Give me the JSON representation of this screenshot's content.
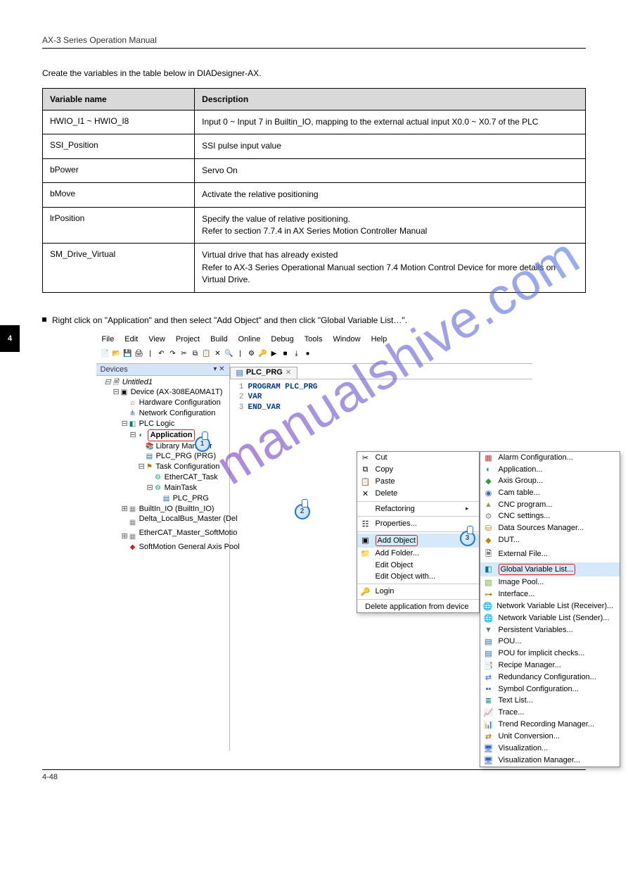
{
  "header": {
    "title": "AX-3 Series Operation Manual"
  },
  "intro": "Create the variables in the table below in DIADesigner-AX.",
  "table": {
    "headers": {
      "name": "Variable name",
      "desc": "Description"
    },
    "rows": [
      {
        "name": "HWIO_I1 ~ HWIO_I8",
        "desc": "Input 0 ~ Input 7 in Builtin_IO, mapping to the external actual input X0.0 ~ X0.7 of the PLC"
      },
      {
        "name": "SSI_Position",
        "desc": "SSI pulse input value"
      },
      {
        "name": "bPower",
        "desc": "Servo On"
      },
      {
        "name": "bMove",
        "desc": "Activate the relative positioning"
      },
      {
        "name": "lrPosition",
        "desc_lines": [
          "Specify the value of relative positioning.",
          "Refer to section 7.7.4 in AX Series Motion Controller Manual"
        ]
      },
      {
        "name": "SM_Drive_Virtual",
        "desc_lines": [
          "Virtual drive that has already existed",
          "Refer to AX-3 Series Operational Manual section 7.4 Motion Control Device for more details on Virtual Drive."
        ]
      }
    ]
  },
  "step": "Right click on \"Application\" and then select \"Add Object\" and then click \"Global Variable List…\".",
  "screenshot": {
    "menubar": [
      "File",
      "Edit",
      "View",
      "Project",
      "Build",
      "Online",
      "Debug",
      "Tools",
      "Window",
      "Help"
    ],
    "devices_title": "Devices",
    "tree": {
      "root": "Untitled1",
      "nodes": [
        "Device (AX-308EA0MA1T)",
        "Hardware Configuration",
        "Network Configuration",
        "PLC Logic",
        "Application",
        "Library Manager",
        "PLC_PRG (PRG)",
        "Task Configuration",
        "EtherCAT_Task",
        "MainTask",
        "PLC_PRG",
        "BuiltIn_IO (BuiltIn_IO)",
        "Delta_LocalBus_Master (Delta LocalBus Master)",
        "EtherCAT_Master_SoftMotion (EtherCAT Master SoftMotion)",
        "SoftMotion General Axis Pool"
      ]
    },
    "editor_tab": "PLC_PRG",
    "editor_code": [
      "PROGRAM PLC_PRG",
      "VAR",
      "END_VAR"
    ],
    "context_menu1": [
      "Cut",
      "Copy",
      "Paste",
      "Delete",
      "Refactoring",
      "Properties...",
      "Add Object",
      "Add Folder...",
      "Edit Object",
      "Edit Object with...",
      "Login",
      "Delete application from device"
    ],
    "context_menu2": [
      "Alarm Configuration...",
      "Application...",
      "Axis Group...",
      "Cam table...",
      "CNC program...",
      "CNC settings...",
      "Data Sources Manager...",
      "DUT...",
      "External File...",
      "Global Variable List...",
      "Image Pool...",
      "Interface...",
      "Network Variable List (Receiver)...",
      "Network Variable List (Sender)...",
      "Persistent Variables...",
      "POU...",
      "POU for implicit checks...",
      "Recipe Manager...",
      "Redundancy Configuration...",
      "Symbol Configuration...",
      "Text List...",
      "Trace...",
      "Trend Recording Manager...",
      "Unit Conversion...",
      "Visualization...",
      "Visualization Manager..."
    ],
    "highlighted": {
      "tree": "Application",
      "menu1": "Add Object",
      "menu2": "Global Variable List..."
    },
    "badges": {
      "n1": "1",
      "n2": "2",
      "n3": "3"
    }
  },
  "watermark": "manualshive.com",
  "footer": {
    "page": "4-48"
  },
  "side_tab": "4"
}
